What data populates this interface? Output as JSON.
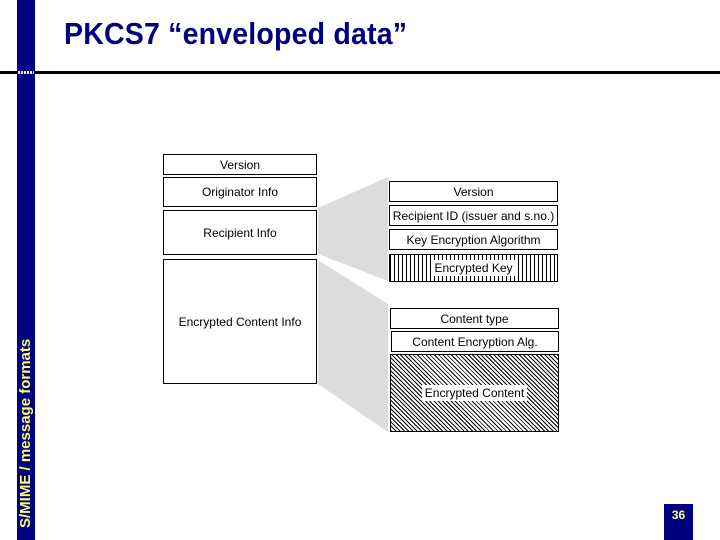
{
  "slide": {
    "title": "PKCS7 “enveloped data”",
    "section_label": "S/MIME / message formats",
    "page_number": "36"
  },
  "colors": {
    "brand_blue": "#000080",
    "accent_yellow": "#ffff66",
    "projection_gray": "#dcdcdc"
  },
  "enveloped_data": {
    "fields": [
      {
        "label": "Version"
      },
      {
        "label": "Originator Info"
      },
      {
        "label": "Recipient Info"
      },
      {
        "label": "Encrypted Content Info"
      }
    ]
  },
  "recipient_info": {
    "fields": [
      {
        "label": "Version"
      },
      {
        "label": "Recipient ID (issuer and s.no.)"
      },
      {
        "label": "Key Encryption Algorithm"
      },
      {
        "label": "Encrypted Key",
        "pattern": "vertical-hatch"
      }
    ]
  },
  "encrypted_content_info": {
    "fields": [
      {
        "label": "Content type"
      },
      {
        "label": "Content Encryption Alg."
      },
      {
        "label": "Encrypted Content",
        "pattern": "diagonal-hatch"
      }
    ]
  }
}
